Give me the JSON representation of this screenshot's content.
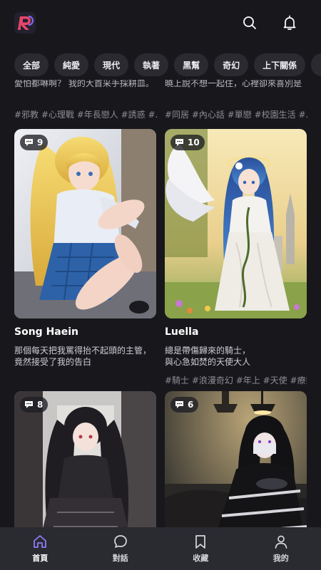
{
  "header": {
    "logo_icon": "app-logo-icon",
    "search_icon": "search-icon",
    "notification_icon": "bell-icon"
  },
  "filters": [
    "全部",
    "純愛",
    "現代",
    "執著",
    "黑幫",
    "奇幻",
    "上下關係"
  ],
  "previous_row": [
    {
      "description": "愛怕都啉啊？ 我的大首采手採耕皿。",
      "tags": "#邪教 #心理戰 #年長戀人 #誘惑 #..."
    },
    {
      "description": "曉上說不想一起住，心裡卻來喜別是",
      "tags": "#同居 #內心話 #單戀 #校園生活 #..."
    }
  ],
  "cards": [
    {
      "name": "Song Haein",
      "comments": "9",
      "description": "那個每天把我罵得抬不起頭的主管，\n竟然接受了我的告白",
      "tags": ""
    },
    {
      "name": "Luella",
      "comments": "10",
      "description": "總是帶傷歸來的騎士，\n與心急如焚的天使大人",
      "tags": "#騎士 #浪漫奇幻 #年上 #天使 #療癒"
    },
    {
      "name": "",
      "comments": "8",
      "description": "",
      "tags": ""
    },
    {
      "name": "",
      "comments": "6",
      "description": "",
      "tags": ""
    }
  ],
  "bottom_nav": [
    {
      "label": "首頁",
      "icon": "home-icon",
      "active": true
    },
    {
      "label": "對話",
      "icon": "chat-icon",
      "active": false
    },
    {
      "label": "收藏",
      "icon": "bookmark-icon",
      "active": false
    },
    {
      "label": "我的",
      "icon": "profile-icon",
      "active": false
    }
  ],
  "colors": {
    "background": "#18171c",
    "chip": "#2b2a31",
    "nav_bar": "#2a2a31",
    "accent": "#8b7cf6",
    "logo_accent": "#e8456b"
  }
}
